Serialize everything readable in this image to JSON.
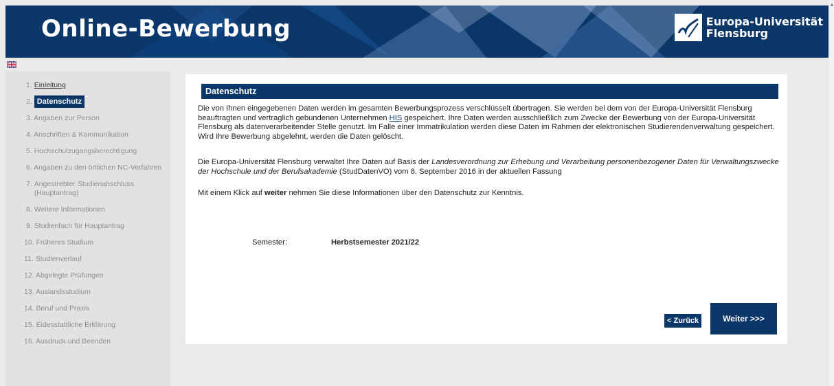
{
  "header": {
    "title": "Online-Bewerbung",
    "logo_line1": "Europa-Universität",
    "logo_line2": "Flensburg",
    "logo_icon": "euf-logo-icon"
  },
  "language_flag": "uk-flag-icon",
  "sidebar": {
    "items": [
      {
        "num": "1.",
        "label": "Einleitung"
      },
      {
        "num": "2.",
        "label": "Datenschutz"
      },
      {
        "num": "3.",
        "label": "Angaben zur Person"
      },
      {
        "num": "4.",
        "label": "Anschriften & Kommunikation"
      },
      {
        "num": "5.",
        "label": "Hochschulzugangsberechtigung"
      },
      {
        "num": "6.",
        "label": "Angaben zu den örtlichen NC-Verfahren"
      },
      {
        "num": "7.",
        "label": "Angestrebter Studienabschluss (Hauptantrag)"
      },
      {
        "num": "8.",
        "label": "Weitere Informationen"
      },
      {
        "num": "9.",
        "label": "Studienfach für Hauptantrag"
      },
      {
        "num": "10.",
        "label": "Früheres Studium"
      },
      {
        "num": "11.",
        "label": "Studienverlauf"
      },
      {
        "num": "12.",
        "label": "Abgelegte Prüfungen"
      },
      {
        "num": "13.",
        "label": "Auslandsstudium"
      },
      {
        "num": "14.",
        "label": "Beruf und Praxis"
      },
      {
        "num": "15.",
        "label": "Eidesstattliche Erklärung"
      },
      {
        "num": "16.",
        "label": "Ausdruck und Beenden"
      }
    ]
  },
  "main": {
    "section_title": "Datenschutz",
    "p1_a": "Die von Ihnen eingegebenen Daten werden im gesamten Bewerbungsprozess verschlüsselt übertragen. Sie werden bei dem von der Europa-Universität Flensburg beauftragten und vertraglich gebundenen Unternehmen ",
    "p1_link": "HIS",
    "p1_b": " gespeichert. Ihre Daten werden ausschließlich zum Zwecke der Bewerbung von der Europa-Universität Flensburg als datenverarbeitender Stelle genutzt. Im Falle einer Immatrikulation werden diese Daten im Rahmen der elektronischen Studierendenverwaltung gespeichert. Wird Ihre Bewerbung abgelehnt, werden die Daten gelöscht.",
    "p2_a": "Die Europa-Universität Flensburg verwaltet Ihre Daten auf Basis der ",
    "p2_italic": "Landesverordnung zur Erhebung und Verarbeitung personenbezogener Daten für Verwaltungszwecke der Hochschule und der Berufsakademie",
    "p2_b": " (StudDatenVO) vom 8. September 2016 in der aktuellen Fassung",
    "p3_a": "Mit einem Klick auf ",
    "p3_bold": "weiter",
    "p3_b": " nehmen Sie diese Informationen über den Datenschutz zur Kenntnis.",
    "semester_label": "Semester:",
    "semester_value": "Herbstsemester 2021/22",
    "back_label": "< Zurück",
    "next_label": "Weiter >>>"
  }
}
